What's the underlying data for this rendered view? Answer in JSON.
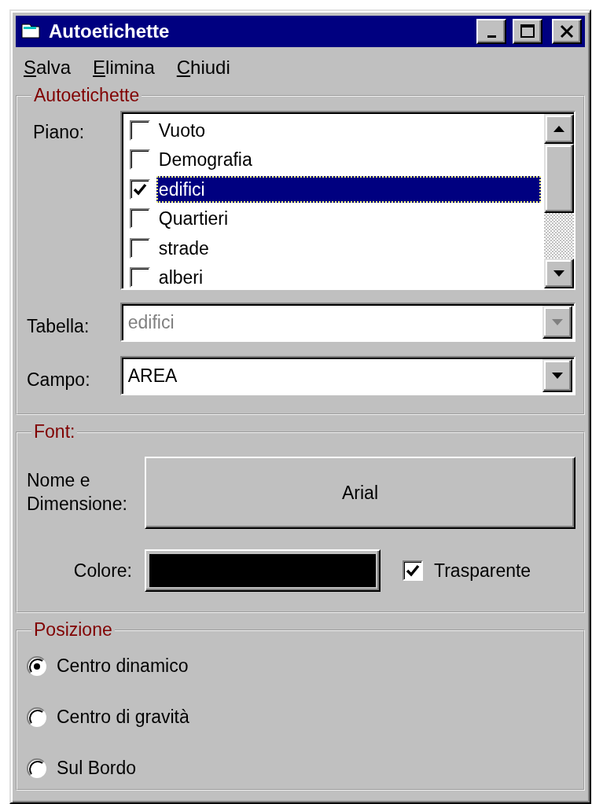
{
  "window": {
    "title": "Autoetichette"
  },
  "menu": [
    {
      "label": "Salva"
    },
    {
      "label": "Elimina"
    },
    {
      "label": "Chiudi"
    }
  ],
  "layers_group": {
    "title": "Autoetichette",
    "piano_label": "Piano:",
    "layers": [
      {
        "label": "Vuoto",
        "checked": false,
        "selected": false
      },
      {
        "label": "Demografia",
        "checked": false,
        "selected": false
      },
      {
        "label": "edifici",
        "checked": true,
        "selected": true
      },
      {
        "label": "Quartieri",
        "checked": false,
        "selected": false
      },
      {
        "label": "strade",
        "checked": false,
        "selected": false
      },
      {
        "label": "alberi",
        "checked": false,
        "selected": false
      }
    ],
    "combos": [
      {
        "label": "Tabella:",
        "value": "edifici",
        "disabled": true
      },
      {
        "label": "Campo:",
        "value": "AREA",
        "disabled": false
      }
    ]
  },
  "font_group": {
    "title": "Font:",
    "name_label": "Nome e Dimensione:",
    "font_button": "Arial",
    "color_label": "Colore:",
    "color": "#000000",
    "transparent": {
      "label": "Trasparente",
      "checked": true
    }
  },
  "position_group": {
    "title": "Posizione",
    "options": [
      {
        "label": "Centro dinamico",
        "selected": true
      },
      {
        "label": "Centro di gravità",
        "selected": false
      },
      {
        "label": "Sul Bordo",
        "selected": false
      }
    ]
  }
}
